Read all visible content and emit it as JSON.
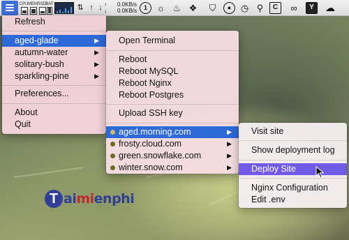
{
  "menubar": {
    "meters": [
      {
        "label": "CPU",
        "level": 0.45
      },
      {
        "label": "MEM",
        "level": 0.7
      },
      {
        "label": "SSD",
        "level": 0.3
      },
      {
        "label": "BAT",
        "level": 0.85
      }
    ],
    "network": {
      "upload": "0.0KB/s",
      "download": "0.0KB/s"
    },
    "icons": [
      "app-menu-icon",
      "cpu-meter-icon",
      "memory-meter-icon",
      "disk-meter-icon",
      "battery-meter-icon",
      "network-graph-icon",
      "network-arrows-icon",
      "one-password-icon",
      "sun-icon",
      "flame-icon",
      "dropbox-icon",
      "shield-icon",
      "github-icon",
      "clock-icon",
      "broom-icon",
      "clipboard-c-icon",
      "glasses-icon",
      "brand-icon",
      "cloud-icon"
    ],
    "brand_letter": "Y"
  },
  "main_menu": {
    "items": [
      {
        "label": "Refresh"
      },
      {
        "label": "aged-glade",
        "has_submenu": true,
        "highlighted": true
      },
      {
        "label": "autumn-water",
        "has_submenu": true
      },
      {
        "label": "solitary-bush",
        "has_submenu": true
      },
      {
        "label": "sparkling-pine",
        "has_submenu": true
      },
      {
        "label": "Preferences..."
      },
      {
        "label": "About"
      },
      {
        "label": "Quit"
      }
    ]
  },
  "server_menu": {
    "items": [
      {
        "label": "Open Terminal"
      },
      {
        "label": "Reboot"
      },
      {
        "label": "Reboot MySQL"
      },
      {
        "label": "Reboot Nginx"
      },
      {
        "label": "Reboot Postgres"
      },
      {
        "label": "Upload SSH key"
      },
      {
        "label": "aged.morning.com",
        "has_submenu": true,
        "highlighted": true
      },
      {
        "label": "frosty.cloud.com",
        "has_submenu": true
      },
      {
        "label": "green.snowflake.com",
        "has_submenu": true
      },
      {
        "label": "winter.snow.com",
        "has_submenu": true
      }
    ]
  },
  "site_menu": {
    "items": [
      {
        "label": "Visit site"
      },
      {
        "label": "Show deployment log"
      },
      {
        "label": "Deploy Site",
        "highlighted": true
      },
      {
        "label": "Nginx Configuration"
      },
      {
        "label": "Edit .env"
      }
    ]
  },
  "watermark": {
    "first": "T",
    "rest_a": "ai",
    "accent": "mi",
    "rest_b": "enphi"
  },
  "colors": {
    "highlight_blue": "#2d69d8",
    "highlight_purple": "#6f5be6",
    "menu_bg": "#f7d6de",
    "site_dot": "#6b6a2a"
  }
}
